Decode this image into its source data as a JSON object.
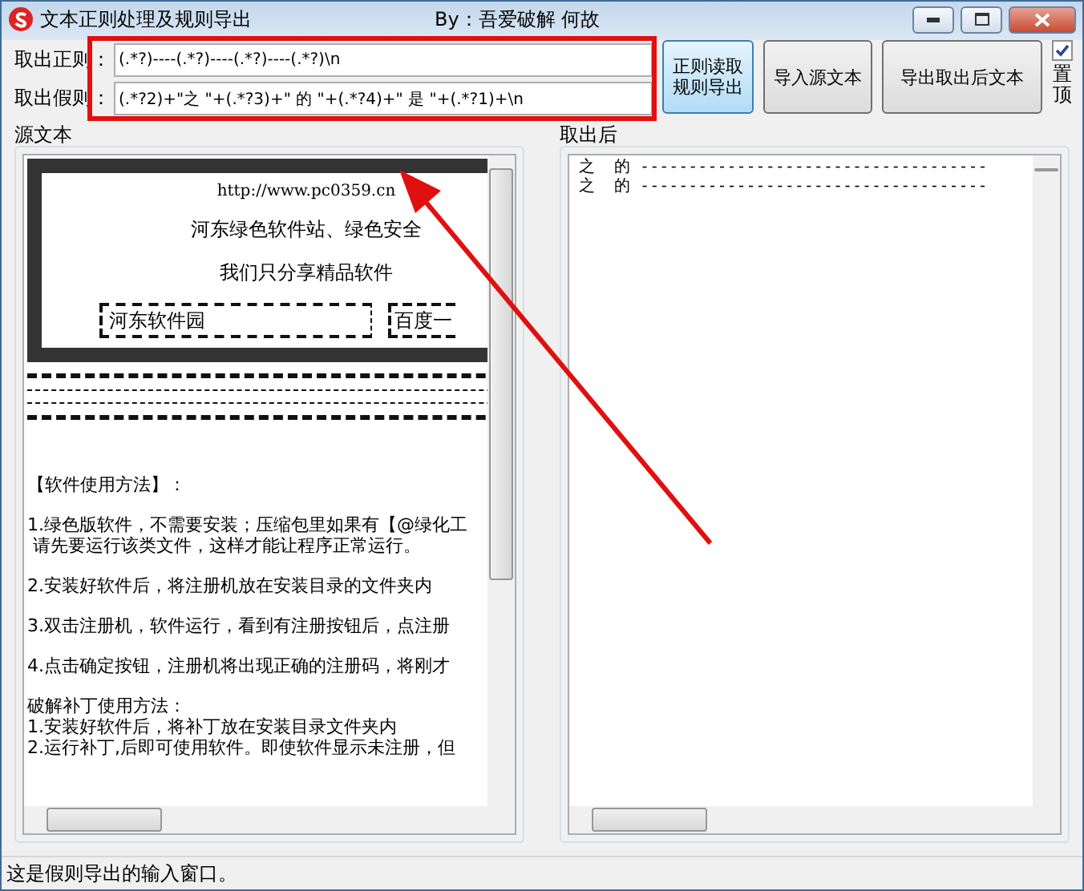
{
  "window": {
    "title": "文本正则处理及规则导出",
    "author": "By：吾爱破解  何故"
  },
  "rules": [
    {
      "label": "取出正则：",
      "value": "(.*?)----(.*?)----(.*?)----(.*?)\\n"
    },
    {
      "label": "取出假则：",
      "value": "(.*?2)+\"之 \"+(.*?3)+\" 的 \"+(.*?4)+\" 是 \"+(.*?1)+\\n"
    }
  ],
  "buttons": [
    {
      "lines": [
        "正则读取",
        "规则导出"
      ],
      "focused": true
    },
    {
      "lines": [
        "导入源文本"
      ],
      "focused": false
    },
    {
      "lines": [
        "导出取出后文本"
      ],
      "focused": false
    }
  ],
  "pin": {
    "label": "置顶",
    "checked": true
  },
  "source": {
    "title": "源文本",
    "banner": {
      "url": "http://www.pc0359.cn",
      "lines": [
        "河东绿色软件站、绿色安全",
        "我们只分享精品软件"
      ],
      "search_box": "河东软件园",
      "search_button": "百度一"
    },
    "paragraphs": [
      [
        "【软件使用方法】："
      ],
      [
        "1.绿色版软件，不需要安装；压缩包里如果有【@绿化工",
        " 请先要运行该类文件，这样才能让程序正常运行。"
      ],
      [
        "2.安装好软件后，将注册机放在安装目录的文件夹内"
      ],
      [
        "3.双击注册机，软件运行，看到有注册按钮后，点注册"
      ],
      [
        "4.点击确定按钮，注册机将出现正确的注册码，将刚才"
      ],
      [
        "破解补丁使用方法：",
        "1.安装好软件后，将补丁放在安装目录文件夹内",
        "2.运行补丁,后即可使用软件。即使软件显示未注册，但"
      ]
    ]
  },
  "output": {
    "title": "取出后",
    "lines": [
      "之  的 ------------------------------------",
      "之  的 ------------------------------------"
    ]
  },
  "status_bar": "这是假则导出的输入窗口。"
}
